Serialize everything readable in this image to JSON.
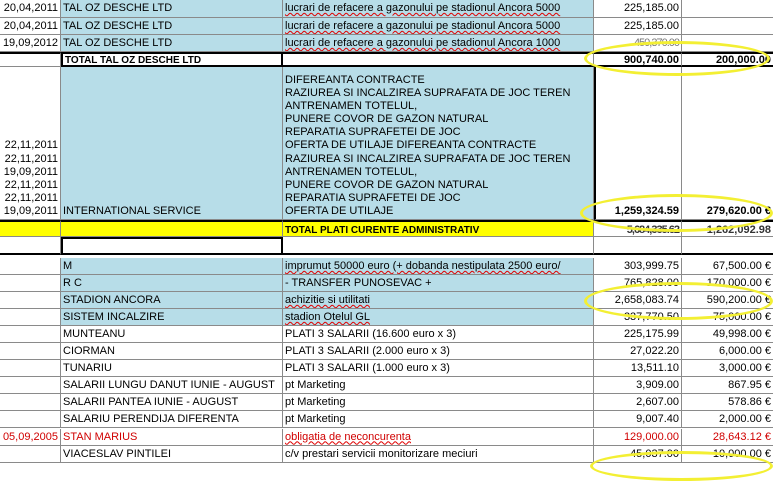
{
  "colors": {
    "highlight_ring": "#f3ef33",
    "blue_fill": "#b7dde8",
    "total_yellow": "#ffff00",
    "red_text": "#d00000"
  },
  "rows_top": [
    {
      "date": "20,04,2011",
      "name": "TAL OZ DESCHE LTD",
      "desc": "lucrari de refacere a gazonului pe stadionul Ancora 5000",
      "amt1": "225,185.00",
      "amt2": ""
    },
    {
      "date": "20,04,2011",
      "name": "TAL OZ DESCHE LTD",
      "desc": "lucrari de refacere a gazonului pe stadionul Ancora 5000",
      "amt1": "225,185.00",
      "amt2": ""
    },
    {
      "date": "19,09,2012",
      "name": "TAL OZ DESCHE LTD",
      "desc": "lucrari de refacere a gazonului pe stadionul Ancora 1000",
      "amt1": "450,370.00",
      "amt2": ""
    }
  ],
  "total_tal": {
    "label": "TOTAL TAL OZ DESCHE LTD",
    "amt1": "900,740.00",
    "amt2": "200,000.00"
  },
  "international": {
    "dates": [
      "22,11,2011",
      "22,11,2011",
      "19,09,2011",
      "22,11,2011",
      "22,11,2011",
      "19,09,2011"
    ],
    "name": "INTERNATIONAL SERVICE",
    "desc_lines": [
      "DIFEREANTA CONTRACTE",
      "RAZIUREA SI INCALZIREA  SUPRAFATA DE JOC  TEREN",
      "ANTRENAMEN TOTELUL,",
      "PUNERE COVOR DE GAZON NATURAL",
      "REPARATIA SUPRAFETEI DE JOC",
      "OFERTA DE UTILAJE DIFEREANTA CONTRACTE",
      "RAZIUREA SI INCALZIREA  SUPRAFATA DE JOC  TEREN",
      "ANTRENAMEN TOTELUL,",
      "PUNERE COVOR DE GAZON NATURAL",
      "REPARATIA SUPRAFETEI DE JOC",
      "OFERTA DE UTILAJE"
    ],
    "amt1": "1,259,324.59",
    "amt2": "279,620.00 €"
  },
  "total_admin": {
    "label": "TOTAL PLATI CURENTE ADMINISTRATIV",
    "amt1": "5,684,335.62",
    "amt2": "1,262,092.98"
  },
  "rows_bottom": [
    {
      "date": "",
      "name": "M",
      "desc": "imprumut 50000 euro (+ dobanda nestipulata 2500 euro/",
      "amt1": "303,999.75",
      "amt2": "67,500.00 €",
      "blue": true,
      "wavy": true
    },
    {
      "date": "",
      "name": "R C",
      "desc": "- TRANSFER PUNOSEVAC +",
      "amt1": "765,828.00",
      "amt2": "170,000.00 €",
      "blue": true,
      "wavy": false
    },
    {
      "date": "",
      "name": "STADION ANCORA",
      "desc": "achizitie si utilitati",
      "amt1": "2,658,083.74",
      "amt2": "590,200.00 €",
      "blue": true,
      "wavy": true
    },
    {
      "date": "",
      "name": "SISTEM INCALZIRE",
      "desc": "stadion Otelul GL",
      "amt1": "337,770.50",
      "amt2": "75,000.00 €",
      "blue": true,
      "wavy": true
    },
    {
      "date": "",
      "name": "MUNTEANU",
      "desc": "PLATI 3 SALARII (16.600 euro x 3)",
      "amt1": "225,175.99",
      "amt2": "49,998.00 €",
      "blue": false,
      "wavy": false
    },
    {
      "date": "",
      "name": "CIORMAN",
      "desc": "PLATI 3 SALARII (2.000 euro x 3)",
      "amt1": "27,022.20",
      "amt2": "6,000.00 €",
      "blue": false,
      "wavy": false
    },
    {
      "date": "",
      "name": "TUNARIU",
      "desc": "PLATI 3 SALARII (1.000 euro x 3)",
      "amt1": "13,511.10",
      "amt2": "3,000.00 €",
      "blue": false,
      "wavy": false
    },
    {
      "date": "",
      "name": "SALARII LUNGU DANUT IUNIE - AUGUST",
      "desc": "pt Marketing",
      "amt1": "3,909.00",
      "amt2": "867.95 €",
      "blue": false,
      "wavy": false
    },
    {
      "date": "",
      "name": "SALARII PANTEA  IUNIE - AUGUST",
      "desc": "pt Marketing",
      "amt1": "2,607.00",
      "amt2": "578.86 €",
      "blue": false,
      "wavy": false
    },
    {
      "date": "",
      "name": "SALARIU PERENDIJA  DIFERENTA",
      "desc": "pt Marketing",
      "amt1": "9,007.40",
      "amt2": "2,000.00 €",
      "blue": false,
      "wavy": false
    },
    {
      "date": "05,09,2005",
      "name": "STAN MARIUS",
      "desc": "obligatia de neconcurenta",
      "amt1": "129,000.00",
      "amt2": "28,643.12 €",
      "blue": false,
      "wavy": true,
      "red": true
    },
    {
      "date": "",
      "name": "VIACESLAV PINTILEI",
      "desc": "c/v prestari servicii monitorizare meciuri",
      "amt1": "45,037.00",
      "amt2": "10,000.00 €",
      "blue": false,
      "wavy": false
    }
  ]
}
